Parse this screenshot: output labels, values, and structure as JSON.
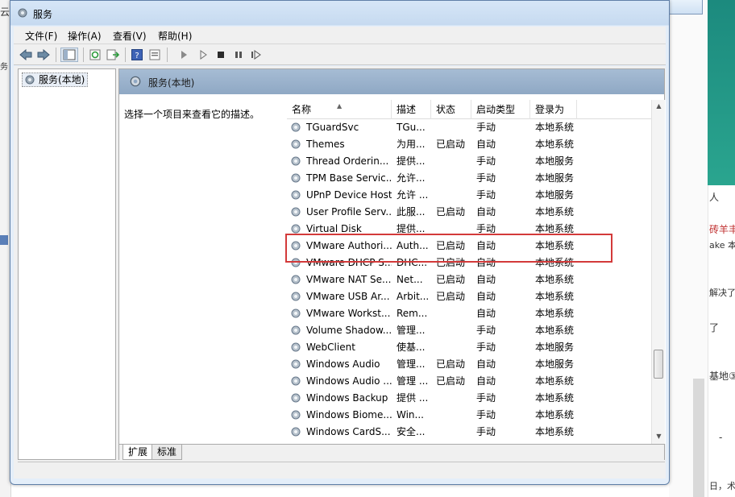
{
  "window": {
    "title": "服务"
  },
  "menubar": {
    "items": [
      "文件(F)",
      "操作(A)",
      "查看(V)",
      "帮助(H)"
    ]
  },
  "toolbar": {
    "icons": [
      "back-arrow-icon",
      "forward-arrow-icon",
      "show-hide-tree-icon",
      "refresh-icon",
      "export-list-icon",
      "help-icon",
      "properties-icon",
      "start-service-icon",
      "start-service-alt-icon",
      "stop-service-icon",
      "pause-service-icon",
      "restart-service-icon"
    ]
  },
  "tree": {
    "root_label": "服务(本地)"
  },
  "panel": {
    "header_title": "服务(本地)",
    "description_prompt": "选择一个项目来查看它的描述。"
  },
  "table": {
    "columns": [
      "名称",
      "描述",
      "状态",
      "启动类型",
      "登录为"
    ],
    "rows": [
      {
        "name": "TGuardSvc",
        "desc": "TGu...",
        "status": "",
        "startup": "手动",
        "logon": "本地系统"
      },
      {
        "name": "Themes",
        "desc": "为用...",
        "status": "已启动",
        "startup": "自动",
        "logon": "本地系统"
      },
      {
        "name": "Thread Orderin...",
        "desc": "提供...",
        "status": "",
        "startup": "手动",
        "logon": "本地服务"
      },
      {
        "name": "TPM Base Servic...",
        "desc": "允许...",
        "status": "",
        "startup": "手动",
        "logon": "本地服务"
      },
      {
        "name": "UPnP Device Host",
        "desc": "允许 ...",
        "status": "",
        "startup": "手动",
        "logon": "本地服务"
      },
      {
        "name": "User Profile Serv...",
        "desc": "此服...",
        "status": "已启动",
        "startup": "自动",
        "logon": "本地系统"
      },
      {
        "name": "Virtual Disk",
        "desc": "提供...",
        "status": "",
        "startup": "手动",
        "logon": "本地系统"
      },
      {
        "name": "VMware Authori...",
        "desc": "Auth...",
        "status": "已启动",
        "startup": "自动",
        "logon": "本地系统"
      },
      {
        "name": "VMware DHCP S...",
        "desc": "DHC...",
        "status": "已启动",
        "startup": "自动",
        "logon": "本地系统"
      },
      {
        "name": "VMware NAT Se...",
        "desc": "Net...",
        "status": "已启动",
        "startup": "自动",
        "logon": "本地系统"
      },
      {
        "name": "VMware USB Ar...",
        "desc": "Arbit...",
        "status": "已启动",
        "startup": "自动",
        "logon": "本地系统"
      },
      {
        "name": "VMware Workst...",
        "desc": "Rem...",
        "status": "",
        "startup": "自动",
        "logon": "本地系统"
      },
      {
        "name": "Volume Shadow...",
        "desc": "管理...",
        "status": "",
        "startup": "手动",
        "logon": "本地系统"
      },
      {
        "name": "WebClient",
        "desc": "使基...",
        "status": "",
        "startup": "手动",
        "logon": "本地服务"
      },
      {
        "name": "Windows Audio",
        "desc": "管理...",
        "status": "已启动",
        "startup": "自动",
        "logon": "本地服务"
      },
      {
        "name": "Windows Audio ...",
        "desc": "管理 ...",
        "status": "已启动",
        "startup": "自动",
        "logon": "本地系统"
      },
      {
        "name": "Windows Backup",
        "desc": "提供 ...",
        "status": "",
        "startup": "手动",
        "logon": "本地系统"
      },
      {
        "name": "Windows Biome...",
        "desc": "Win...",
        "status": "",
        "startup": "手动",
        "logon": "本地系统"
      },
      {
        "name": "Windows CardS...",
        "desc": "安全...",
        "status": "",
        "startup": "手动",
        "logon": "本地系统"
      }
    ],
    "highlighted_row": "VMware Authori..."
  },
  "tabs": {
    "extended": "扩展",
    "standard": "标准"
  },
  "background": {
    "left_fragments": [
      "云",
      "务"
    ],
    "right_fragments": [
      "人",
      "砖羊丰",
      "ake 本",
      "解决了",
      "了",
      "基地③",
      "-",
      "日，术"
    ]
  },
  "colors": {
    "highlight_border": "#d33a3a",
    "panel_header": "#a6bcd4"
  }
}
